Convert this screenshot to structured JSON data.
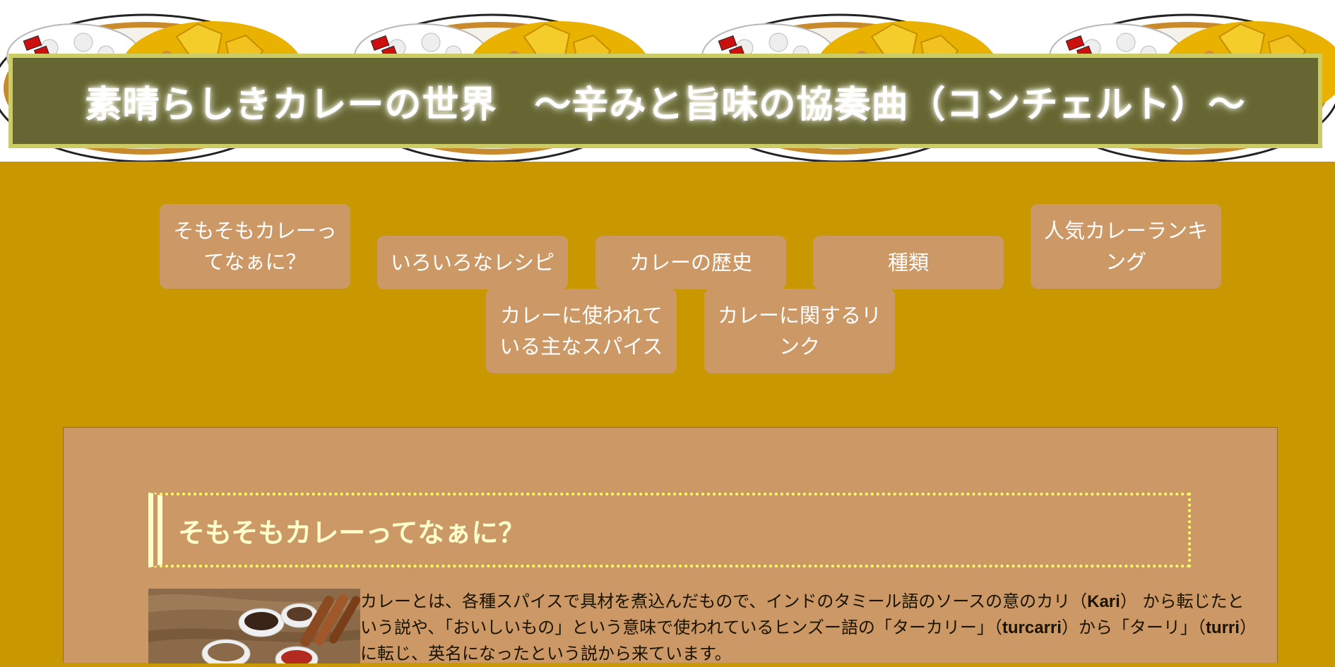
{
  "header": {
    "title": "素晴らしきカレーの世界　～辛みと旨味の協奏曲（コンチェルト）～"
  },
  "nav": {
    "items": [
      {
        "label": "そもそもカレーってなぁに？"
      },
      {
        "label": "いろいろなレシピ"
      },
      {
        "label": "カレーの歴史"
      },
      {
        "label": "種類"
      },
      {
        "label": "人気カレーランキング"
      },
      {
        "label": "カレーに使われている主なスパイス"
      },
      {
        "label": "カレーに関するリンク"
      }
    ]
  },
  "section": {
    "heading": "そもそもカレーってなぁに？",
    "intro": {
      "t1": "カレーとは、各種スパイスで具材を煮込んだもので、インドのタミール語のソースの意のカリ（",
      "b1": "Kari",
      "t2": "） から転じたという説や、「おいしいもの」という意味で使われているヒンズー語の「ターカリー」（",
      "b2": "turcarri",
      "t3": "）から「ターリ」（",
      "b3": "turri",
      "t4": "）に転じ、英名になったという説から来ています。"
    }
  },
  "colors": {
    "page_bg": "#c99800",
    "banner_title_bg": "#666633",
    "banner_title_border": "#cccc66",
    "nav_button_bg": "#cc9966",
    "panel_bg": "#cc9966",
    "heading_text": "#ffffcc",
    "heading_border": "#ffff66"
  }
}
